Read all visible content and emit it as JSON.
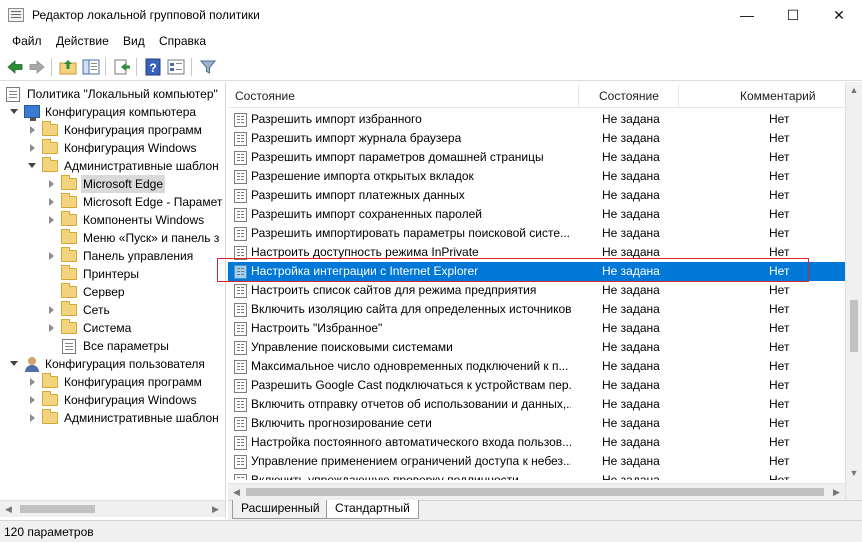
{
  "window": {
    "title": "Редактор локальной групповой политики",
    "controls": {
      "minimize": "—",
      "maximize": "☐",
      "close": "✕"
    }
  },
  "menu": [
    "Файл",
    "Действие",
    "Вид",
    "Справка"
  ],
  "toolbar": {
    "icons": [
      "back-arrow-icon",
      "forward-arrow-icon",
      "up-folder-icon",
      "show-hide-tree-icon",
      "export-list-icon",
      "help-icon",
      "properties-icon",
      "filter-icon"
    ]
  },
  "tree": {
    "root": "Политика \"Локальный компьютер\"",
    "computer_config": "Конфигурация компьютера",
    "comp_children": {
      "software": "Конфигурация программ",
      "windows": "Конфигурация Windows",
      "admin_templates": "Административные шаблон"
    },
    "admin_children": {
      "edge": "Microsoft Edge",
      "edge_params": "Microsoft Edge - Парамет",
      "components": "Компоненты Windows",
      "start_menu": "Меню «Пуск» и панель з",
      "control_panel": "Панель управления",
      "printers": "Принтеры",
      "server": "Сервер",
      "network": "Сеть",
      "system": "Система",
      "all_params": "Все параметры"
    },
    "user_config": "Конфигурация пользователя",
    "user_children": {
      "software": "Конфигурация программ",
      "windows": "Конфигурация Windows",
      "admin_templates": "Административные шаблон"
    }
  },
  "list": {
    "headers": {
      "name": "Состояние",
      "state": "Состояние",
      "comment": "Комментарий"
    },
    "rows": [
      {
        "name": "Разрешить импорт избранного",
        "state": "Не задана",
        "comment": "Нет",
        "selected": false
      },
      {
        "name": "Разрешить импорт журнала браузера",
        "state": "Не задана",
        "comment": "Нет",
        "selected": false
      },
      {
        "name": "Разрешить импорт параметров домашней страницы",
        "state": "Не задана",
        "comment": "Нет",
        "selected": false
      },
      {
        "name": "Разрешение импорта открытых вкладок",
        "state": "Не задана",
        "comment": "Нет",
        "selected": false
      },
      {
        "name": "Разрешить импорт платежных данных",
        "state": "Не задана",
        "comment": "Нет",
        "selected": false
      },
      {
        "name": "Разрешить импорт сохраненных паролей",
        "state": "Не задана",
        "comment": "Нет",
        "selected": false
      },
      {
        "name": "Разрешить импортировать параметры поисковой систе...",
        "state": "Не задана",
        "comment": "Нет",
        "selected": false
      },
      {
        "name": "Настроить доступность режима InPrivate",
        "state": "Не задана",
        "comment": "Нет",
        "selected": false
      },
      {
        "name": "Настройка интеграции с Internet Explorer",
        "state": "Не задана",
        "comment": "Нет",
        "selected": true
      },
      {
        "name": "Настроить список сайтов для режима предприятия",
        "state": "Не задана",
        "comment": "Нет",
        "selected": false
      },
      {
        "name": "Включить изоляцию сайта для определенных источников",
        "state": "Не задана",
        "comment": "Нет",
        "selected": false
      },
      {
        "name": "Настроить \"Избранное\"",
        "state": "Не задана",
        "comment": "Нет",
        "selected": false
      },
      {
        "name": "Управление поисковыми системами",
        "state": "Не задана",
        "comment": "Нет",
        "selected": false
      },
      {
        "name": "Максимальное число одновременных подключений к п...",
        "state": "Не задана",
        "comment": "Нет",
        "selected": false
      },
      {
        "name": "Разрешить Google Cast подключаться к устройствам пер...",
        "state": "Не задана",
        "comment": "Нет",
        "selected": false
      },
      {
        "name": "Включить отправку отчетов об использовании и данных,...",
        "state": "Не задана",
        "comment": "Нет",
        "selected": false
      },
      {
        "name": "Включить прогнозирование сети",
        "state": "Не задана",
        "comment": "Нет",
        "selected": false
      },
      {
        "name": "Настройка постоянного автоматического входа пользов...",
        "state": "Не задана",
        "comment": "Нет",
        "selected": false
      },
      {
        "name": "Управление применением ограничений доступа к небез...",
        "state": "Не задана",
        "comment": "Нет",
        "selected": false
      },
      {
        "name": "Включить упреждающую проверку подлинности",
        "state": "Не задана",
        "comment": "Нет",
        "selected": false
      }
    ]
  },
  "tabs": {
    "extended": "Расширенный",
    "standard": "Стандартный"
  },
  "status": {
    "count": "120 параметров"
  },
  "colors": {
    "selection": "#0078d7",
    "highlight_frame": "#d9242c"
  }
}
